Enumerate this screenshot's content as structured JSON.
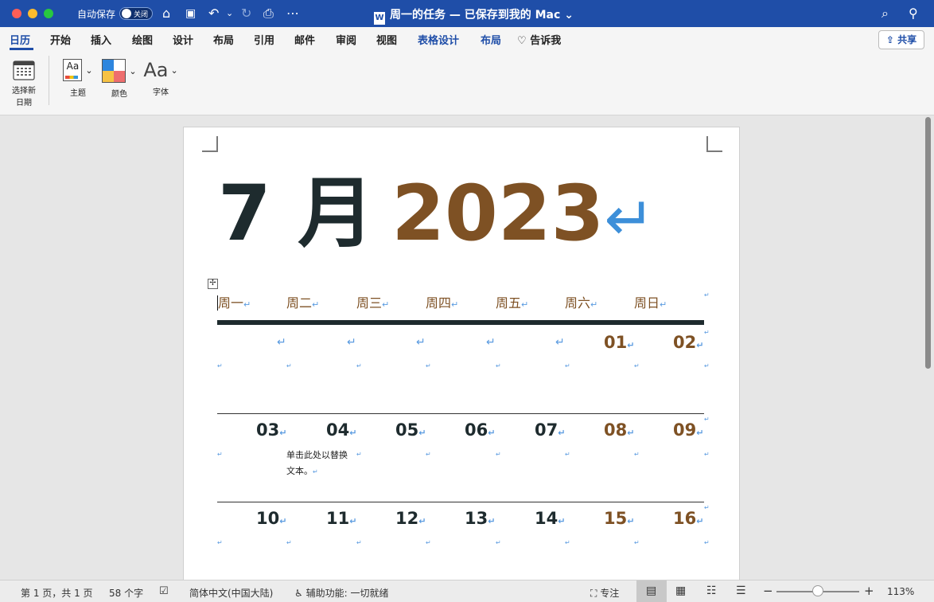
{
  "titlebar": {
    "autosave_label": "自动保存",
    "autosave_state": "关闭",
    "document_title": "周一的任务 — 已保存到我的 Mac",
    "title_chevron": "⌄",
    "icons": [
      "home-icon",
      "save-icon",
      "undo-icon",
      "redo-icon",
      "print-icon",
      "more-icon",
      "search-icon",
      "account-icon"
    ],
    "glyphs": {
      "home": "⌂",
      "save": "▣",
      "undo": "↶",
      "undo_menu": "⌄",
      "redo": "↻",
      "print": "⎙",
      "more": "⋯",
      "search": "⌕",
      "account": "⚲",
      "doc": "W"
    }
  },
  "tabs": [
    {
      "label": "日历"
    },
    {
      "label": "开始"
    },
    {
      "label": "插入"
    },
    {
      "label": "绘图"
    },
    {
      "label": "设计"
    },
    {
      "label": "布局"
    },
    {
      "label": "引用"
    },
    {
      "label": "邮件"
    },
    {
      "label": "审阅"
    },
    {
      "label": "视图"
    },
    {
      "label": "表格设计"
    },
    {
      "label": "布局"
    }
  ],
  "tell_me": {
    "icon": "lightbulb-icon",
    "glyph": "♡",
    "label": "告诉我"
  },
  "share": {
    "icon": "share-icon",
    "glyph": "⇪",
    "label": "共享"
  },
  "ribbon": {
    "select_date": {
      "line1": "选择新",
      "line2": "日期"
    },
    "theme": {
      "label": "主题",
      "glyph": "Aa"
    },
    "colors": {
      "label": "颜色"
    },
    "fonts": {
      "label": "字体",
      "glyph": "Aa"
    },
    "dropdown_glyph": "⌄"
  },
  "document": {
    "month": "7 月",
    "year": "2023",
    "para_mark": "↵",
    "cell_mark": "↵",
    "move_handle": "✢",
    "weekdays": [
      "周一",
      "周二",
      "周三",
      "周四",
      "周五",
      "周六",
      "周日"
    ],
    "weeks": [
      [
        "",
        "",
        "",
        "",
        "",
        "01",
        "02"
      ],
      [
        "03",
        "04",
        "05",
        "06",
        "07",
        "08",
        "09"
      ],
      [
        "10",
        "11",
        "12",
        "13",
        "14",
        "15",
        "16"
      ]
    ],
    "placeholder_line1": "单击此处以替换",
    "placeholder_line2": "文本。"
  },
  "colors": {
    "accent": "#1f4ea8",
    "month_color": "#1e2b2e",
    "year_color": "#7e5124",
    "weekend_color": "#7e5124",
    "mark_color": "#5a9be0"
  },
  "status": {
    "page": "第 1 页，共 1 页",
    "words": "58 个字",
    "language": "简体中文(中国大陆)",
    "accessibility": "辅助功能: 一切就绪",
    "focus": "专注",
    "zoom": "113%",
    "zoom_minus": "−",
    "zoom_plus": "+",
    "proof_glyph": "☑",
    "access_glyph": "♿",
    "focus_glyph": "⛶",
    "view_glyphs": [
      "▤",
      "▦",
      "☷",
      "☰"
    ],
    "zoom_level": 0.5
  }
}
